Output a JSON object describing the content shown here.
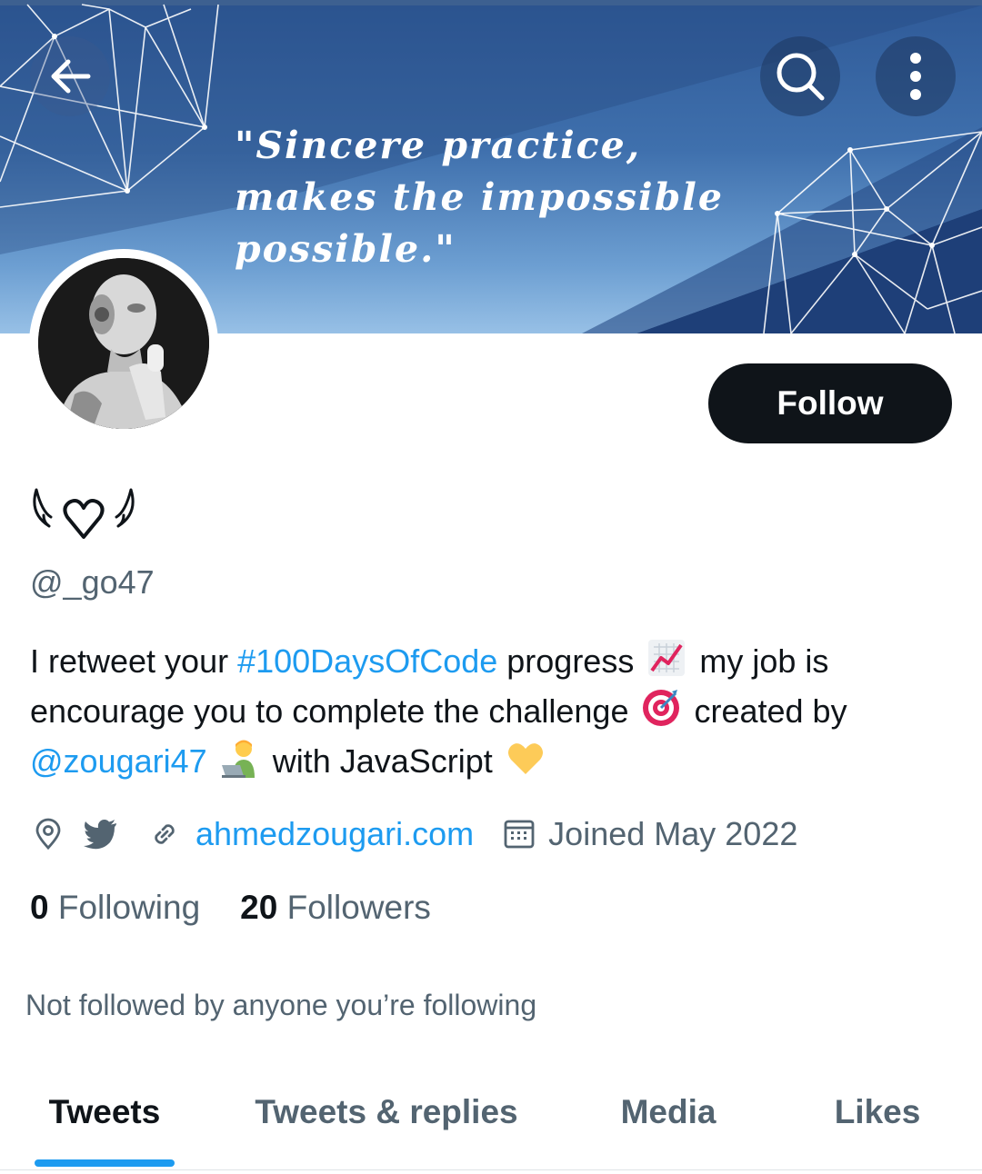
{
  "banner": {
    "quote": "\"Sincere practice, makes the impossible possible.\""
  },
  "header": {
    "back_icon": "arrow-left-icon",
    "search_icon": "search-icon",
    "more_icon": "more-vertical-icon"
  },
  "profile": {
    "display_name": "ᥫ᭡",
    "handle": "@_go47",
    "follow_label": "Follow",
    "bio": {
      "part1": "I retweet your ",
      "hashtag": "#100DaysOfCode",
      "part2": " progress ",
      "emoji1": "chart-increasing-icon",
      "part3": " my job is encourage you to complete the challenge ",
      "emoji2": "direct-hit-icon",
      "part4": " created by ",
      "mention": "@zougari47",
      "emoji3": "technologist-icon",
      "part5": " with JavaScript ",
      "emoji4": "yellow-heart-icon"
    },
    "meta": {
      "location_icon": "location-pin-icon",
      "twitter_icon": "twitter-bird-icon",
      "link_icon": "link-icon",
      "website": "ahmedzougari.com",
      "calendar_icon": "calendar-icon",
      "joined": "Joined May 2022"
    },
    "stats": {
      "following_count": "0",
      "following_label": "Following",
      "followers_count": "20",
      "followers_label": "Followers"
    },
    "not_followed": "Not followed by anyone you’re following"
  },
  "tabs": [
    {
      "label": "Tweets",
      "active": true
    },
    {
      "label": "Tweets & replies",
      "active": false
    },
    {
      "label": "Media",
      "active": false
    },
    {
      "label": "Likes",
      "active": false
    }
  ],
  "colors": {
    "accent": "#1d9bf0",
    "text_primary": "#0f1419",
    "text_secondary": "#536471",
    "follow_button": "#0f1419"
  }
}
